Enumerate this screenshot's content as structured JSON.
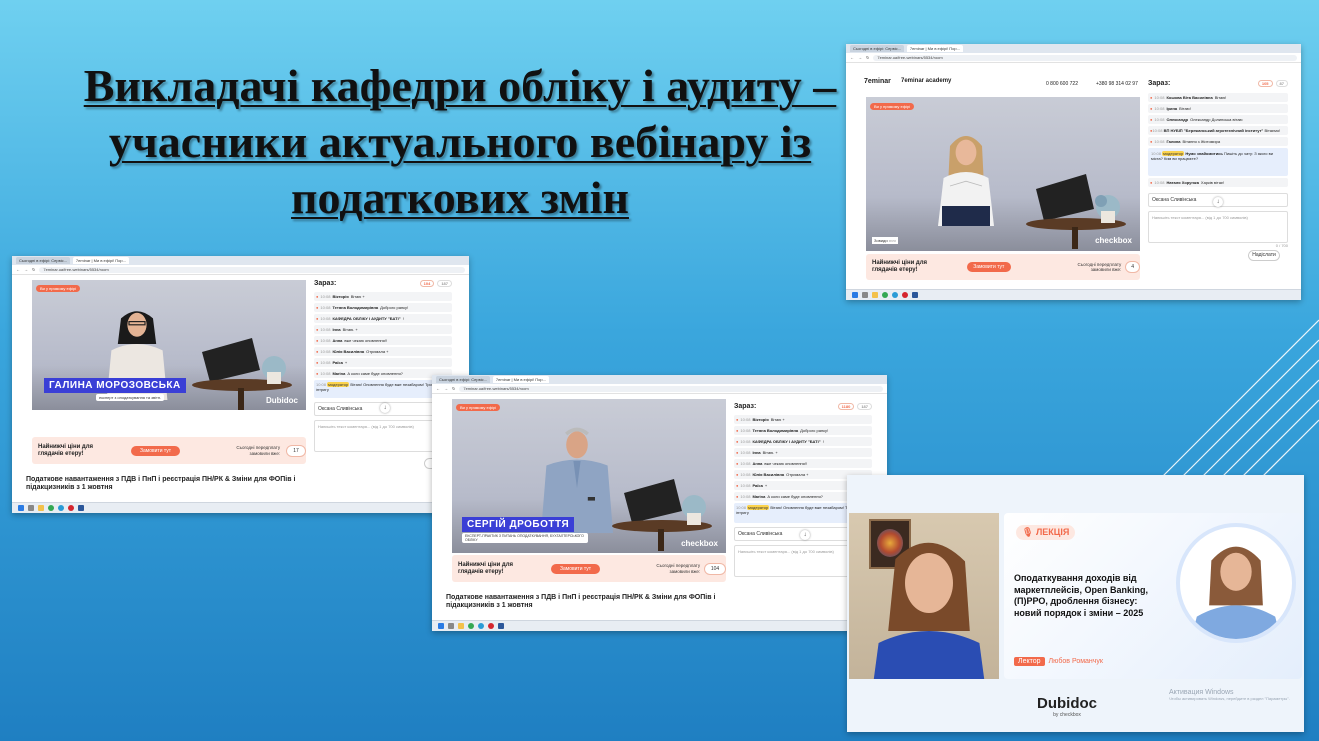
{
  "slide": {
    "title": "Викладачі кафедри обліку і аудиту – учасники актуального вебінару із податкових змін"
  },
  "colors": {
    "accent": "#f26a4b",
    "promo_bg": "#fde8e1",
    "nameplate": "#3a3fd6"
  },
  "shot_top": {
    "tabs": [
      "Сьогодні в ефірі: Сервіс...",
      "7eminar | Ми в ефірі! Пор..."
    ],
    "url": "7eminar.ua/free-webinars/5534/room",
    "logo_left": "7eminar",
    "logo_right": "7eminar academy",
    "phone_1": "0 800 600 722",
    "phone_2": "+380 98 314 02 97",
    "video_brand": "checkbox",
    "live_label": "Ви у прямому ефірі",
    "sub_overlay": "Зовиди ○○○",
    "promo_text": "Найнижчі ціни для глядачів етеру!",
    "promo_button": "Замовити тут",
    "promo_note": "Сьогодні передплату замовили вже:",
    "promo_count": "4",
    "chat": {
      "title": "Зараз:",
      "badge_left": "105",
      "badge_right": "87",
      "messages": [
        {
          "time": "10:08",
          "name": "Кошова Віта Василівна",
          "text": "Вітаю!"
        },
        {
          "time": "10:08",
          "name": "Ірина",
          "text": "Вітаю!"
        },
        {
          "time": "10:08",
          "name": "Олександр",
          "text": "Олександр Долинська вітаю"
        },
        {
          "time": "10:08",
          "name": "ВП НУБІП \"Бережанський агротехнічний інститут\"",
          "text": "Вітаємо!"
        },
        {
          "time": "10:08",
          "name": "Галина",
          "text": "Вітання з Житомира"
        },
        {
          "time": "10:08",
          "tag": "модератор",
          "name": "Нумо знайомитись",
          "text": "Пишіть до чату: З якого ви міста? Ким ви працюєте?"
        },
        {
          "time": "10:08",
          "name": "Наталя Хорунжа",
          "text": "Харків вітає!"
        }
      ],
      "name_value": "Оксана Сливінська",
      "comment_placeholder": "Напишіть текст коментаря... (від 1 до 700 символів)",
      "counter": "0 / 700",
      "send_label": "Надіслати"
    }
  },
  "shot_left": {
    "tabs": [
      "Сьогодні в ефірі: Сервіс...",
      "7eminar | Ми в ефірі! Пор..."
    ],
    "url": "7eminar.ua/free-webinars/5534/room",
    "live_label": "Ви у прямому ефірі",
    "speaker_name": "ГАЛИНА МОРОЗОВСЬКА",
    "speaker_role": "експерт з оподаткування та звітн.",
    "video_brand": "Dubidoc",
    "promo_text": "Найнижчі ціни для глядачів етеру!",
    "promo_button": "Замовити тут",
    "promo_note": "Сьогодні передплату замовили вже:",
    "promo_count": "17",
    "webinar_title": "Податкове навантаження з ПДВ і ПнП і реєстрація ПН/РК & Зміни для ФОПів і підакцизників з 1 жовтня",
    "chat": {
      "title": "Зараз:",
      "badge_left": "104",
      "badge_right": "187",
      "messages": [
        {
          "time": "10:08",
          "name": "Вікторія",
          "text": "Вітаю +"
        },
        {
          "time": "10:08",
          "name": "Тетяна Володимирівна",
          "text": "Доброго ранку!"
        },
        {
          "time": "10:08",
          "name": "КАФЕДРА ОБЛІКУ І АУДИТУ \"БАТІ\"",
          "text": "!"
        },
        {
          "time": "10:08",
          "name": "Інна",
          "text": "Вітаю. +"
        },
        {
          "time": "10:08",
          "name": "Анна",
          "text": "вже чекаю оновлення!!"
        },
        {
          "time": "10:08",
          "name": "Юлія Василівна",
          "text": "Отримала +"
        },
        {
          "time": "10:08",
          "name": "Раїса",
          "text": "+"
        },
        {
          "time": "10:08",
          "name": "Marina",
          "text": "А коли саме буде оновлення?"
        },
        {
          "time": "10:08",
          "tag": "модератор",
          "name": "",
          "text": "Вітаю! Оновлення буде вже незабаром! Тримаємо інтригу"
        }
      ],
      "name_value": "Оксана Сливінська",
      "comment_placeholder": "Напишіть текст коментаря... (від 1 до 700 символів)",
      "send_label": "На"
    }
  },
  "shot_mid": {
    "tabs": [
      "Сьогодні в ефірі: Сервіс...",
      "7eminar | Ми в ефірі! Пор..."
    ],
    "url": "7eminar.ua/free-webinars/5534/room",
    "live_label": "Ви у прямому ефірі",
    "speaker_name": "СЕРГІЙ ДРОБОТТЯ",
    "speaker_role": "ЕКСПЕРТ-ПРАКТИК З ПИТАНЬ ОПОДАТКУВАННЯ, БУХГАЛТЕРСЬКОГО ОБЛІКУ",
    "video_brand": "checkbox",
    "promo_text": "Найнижчі ціни для глядачів етеру!",
    "promo_button": "Замовити тут",
    "promo_note": "Сьогодні передплату замовили вже:",
    "promo_count": "104",
    "webinar_title": "Податкове навантаження з ПДВ і ПнП і реєстрація ПН/РК & Зміни для ФОПів і підакцизників з 1 жовтня",
    "chat": {
      "title": "Зараз:",
      "badge_left": "1180",
      "badge_right": "187",
      "messages": [
        {
          "time": "10:08",
          "name": "Вікторія",
          "text": "Вітаю +"
        },
        {
          "time": "10:08",
          "name": "Тетяна Володимирівна",
          "text": "Доброго ранку!"
        },
        {
          "time": "10:08",
          "name": "КАФЕДРА ОБЛІКУ І АУДИТУ \"БАТІ\"",
          "text": "!"
        },
        {
          "time": "10:08",
          "name": "Інна",
          "text": "Вітаю. +"
        },
        {
          "time": "10:08",
          "name": "Анна",
          "text": "вже чекаю оновлення!!"
        },
        {
          "time": "10:08",
          "name": "Юлія Василівна",
          "text": "Отримала +"
        },
        {
          "time": "10:08",
          "name": "Раїса",
          "text": "+"
        },
        {
          "time": "10:08",
          "name": "Marina",
          "text": "А коли саме буде оновлення?"
        },
        {
          "time": "10:08",
          "tag": "модератор",
          "name": "",
          "text": "Вітаю! Оновлення буде вже незабаром! Тримаємо інтригу"
        }
      ],
      "name_value": "Оксана Сливінська",
      "comment_placeholder": "Напишіть текст коментаря... (від 1 до 700 символів)"
    }
  },
  "lecture": {
    "tag": "ЛЕКЦІЯ",
    "title": "Оподаткування доходів від маркетплейсів, Open Banking, (П)РРО, дроблення бізнесу: новий порядок і зміни – 2025",
    "role_label": "Лектор",
    "lecturer": "Любов Романчук",
    "brand": "Dubidoc",
    "brand_sub": "by checkbox",
    "win_activation": "Активация Windows",
    "win_activation_sub": "Чтобы активировать Windows, перейдите в раздел \"Параметры\"."
  }
}
